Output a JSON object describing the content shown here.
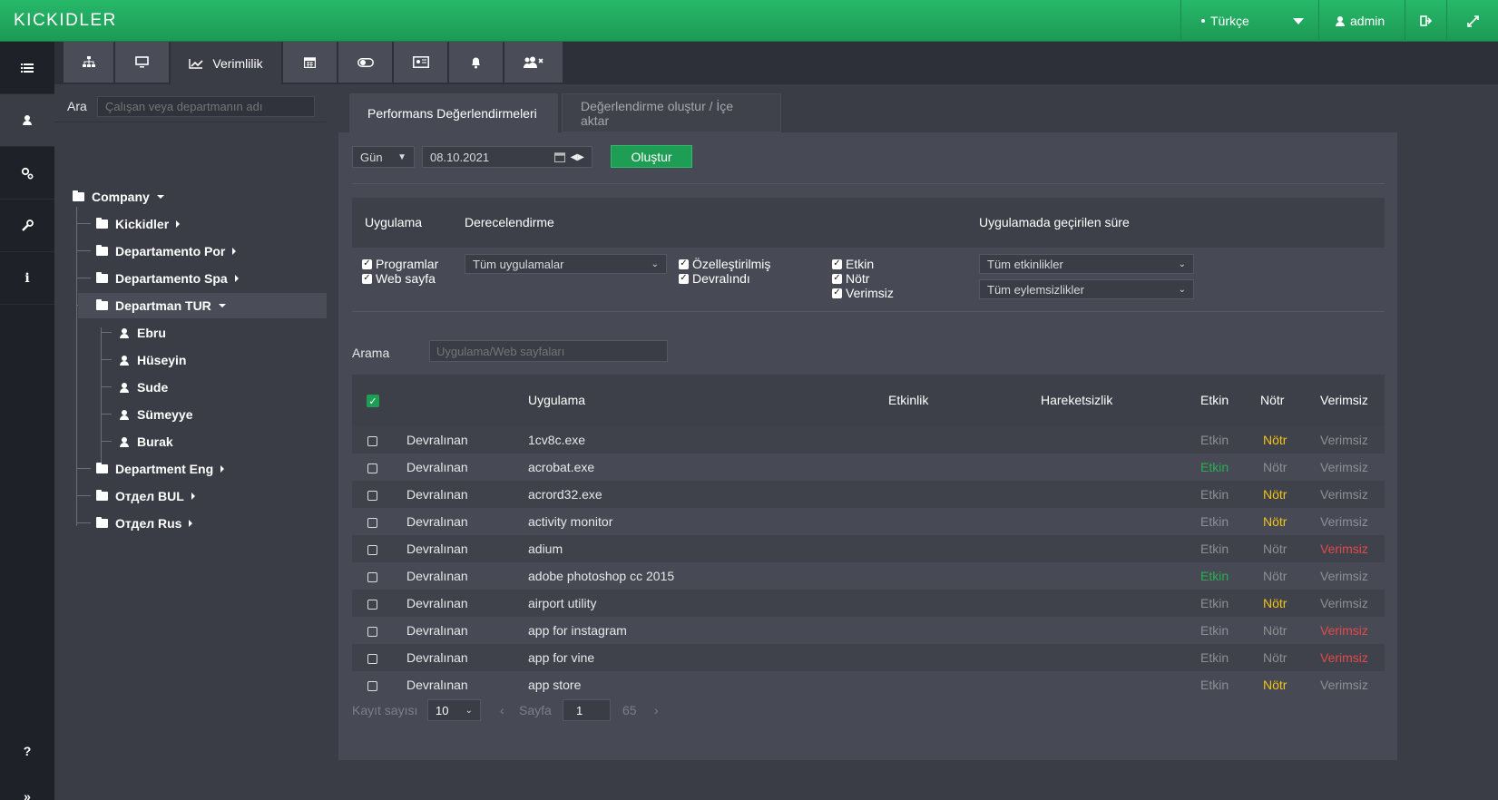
{
  "topbar": {
    "logo": "KICKIDLER",
    "language": "Türkçe",
    "user": "admin"
  },
  "leftnav": {
    "items": [
      "list-icon",
      "user-icon",
      "settings-icon",
      "wrench-icon",
      "info-icon"
    ],
    "help": "?",
    "expand": "»"
  },
  "toolbar": {
    "tabs": [
      {
        "icon": "org-chart-icon",
        "label": ""
      },
      {
        "icon": "monitor-icon",
        "label": ""
      },
      {
        "icon": "line-chart-icon",
        "label": "Verimlilik"
      },
      {
        "icon": "calendar-icon",
        "label": ""
      },
      {
        "icon": "toggle-icon",
        "label": ""
      },
      {
        "icon": "id-card-icon",
        "label": ""
      },
      {
        "icon": "bell-icon",
        "label": ""
      },
      {
        "icon": "users-remove-icon",
        "label": ""
      }
    ]
  },
  "sidebar": {
    "search_label": "Ara",
    "search_placeholder": "Çalışan veya departmanın adı",
    "tree": {
      "root": "Company",
      "departments": [
        "Kickidler",
        "Departamento Por",
        "Departamento Spa",
        "Departman TUR",
        "Department Eng",
        "Отдел BUL",
        "Отдел Rus"
      ],
      "employees": [
        "Ebru",
        "Hüseyin",
        "Sude",
        "Sümeyye",
        "Burak"
      ]
    }
  },
  "main": {
    "tab_active": "Performans Değerlendirmeleri",
    "tab_inactive": "Değerlendirme oluştur / İçe aktar",
    "period": "Gün",
    "date": "08.10.2021",
    "create_button": "Oluştur",
    "filters": {
      "col_app": "Uygulama",
      "col_rating": "Derecelendirme",
      "col_time": "Uygulamada geçirilen süre",
      "programs": "Programlar",
      "websites": "Web sayfa",
      "app_select": "Tüm uygulamalar",
      "customized": "Özelleştirilmiş",
      "inherited": "Devralındı",
      "effective": "Etkin",
      "neutral": "Nötr",
      "ineffective": "Verimsiz",
      "activity_select": "Tüm etkinlikler",
      "inactivity_select": "Tüm eylemsizlikler"
    },
    "search_label": "Arama",
    "search_placeholder": "Uygulama/Web sayfaları",
    "table": {
      "headers": {
        "app": "Uygulama",
        "activity": "Etkinlik",
        "inactivity": "Hareketsizlik",
        "effective": "Etkin",
        "neutral": "Nötr",
        "ineffective": "Verimsiz"
      },
      "rows": [
        {
          "source": "Devralınan",
          "app": "1cv8c.exe",
          "effective": "Etkin",
          "neutral": "Nötr",
          "ineffective": "Verimsiz",
          "rating": "neutral"
        },
        {
          "source": "Devralınan",
          "app": "acrobat.exe",
          "effective": "Etkin",
          "neutral": "Nötr",
          "ineffective": "Verimsiz",
          "rating": "effective"
        },
        {
          "source": "Devralınan",
          "app": "acrord32.exe",
          "effective": "Etkin",
          "neutral": "Nötr",
          "ineffective": "Verimsiz",
          "rating": "neutral"
        },
        {
          "source": "Devralınan",
          "app": "activity monitor",
          "effective": "Etkin",
          "neutral": "Nötr",
          "ineffective": "Verimsiz",
          "rating": "neutral"
        },
        {
          "source": "Devralınan",
          "app": "adium",
          "effective": "Etkin",
          "neutral": "Nötr",
          "ineffective": "Verimsiz",
          "rating": "ineffective"
        },
        {
          "source": "Devralınan",
          "app": "adobe photoshop cc 2015",
          "effective": "Etkin",
          "neutral": "Nötr",
          "ineffective": "Verimsiz",
          "rating": "effective"
        },
        {
          "source": "Devralınan",
          "app": "airport utility",
          "effective": "Etkin",
          "neutral": "Nötr",
          "ineffective": "Verimsiz",
          "rating": "neutral"
        },
        {
          "source": "Devralınan",
          "app": "app for instagram",
          "effective": "Etkin",
          "neutral": "Nötr",
          "ineffective": "Verimsiz",
          "rating": "ineffective"
        },
        {
          "source": "Devralınan",
          "app": "app for vine",
          "effective": "Etkin",
          "neutral": "Nötr",
          "ineffective": "Verimsiz",
          "rating": "ineffective"
        },
        {
          "source": "Devralınan",
          "app": "app store",
          "effective": "Etkin",
          "neutral": "Nötr",
          "ineffective": "Verimsiz",
          "rating": "neutral"
        }
      ]
    },
    "pager": {
      "records_label": "Kayıt sayısı",
      "records_value": "10",
      "prev": "‹",
      "page_label": "Sayfa",
      "page_value": "1",
      "total_pages": "65",
      "next": "›"
    }
  },
  "colors": {
    "effective": "#27b04f",
    "neutral": "#f0c419",
    "ineffective": "#e04a4a",
    "muted": "#8d8f95",
    "accent": "#1e9e55"
  }
}
